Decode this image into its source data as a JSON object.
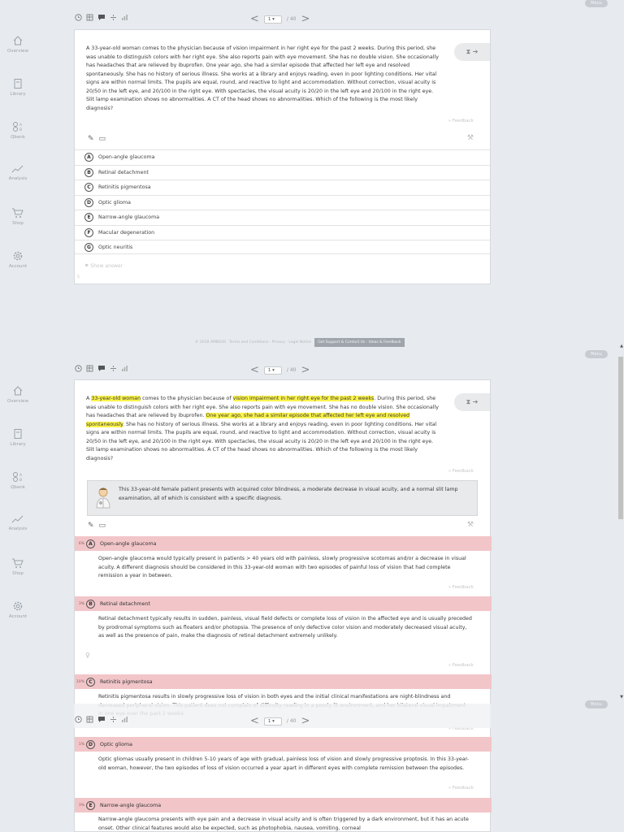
{
  "menu_label": "Menu",
  "sidebar": [
    {
      "label": "Overview",
      "icon": "home-icon"
    },
    {
      "label": "Library",
      "icon": "library-icon"
    },
    {
      "label": "Qbank",
      "icon": "qbank-icon"
    },
    {
      "label": "Analysis",
      "icon": "analysis-icon"
    },
    {
      "label": "Shop",
      "icon": "shop-icon"
    },
    {
      "label": "Account",
      "icon": "gear-icon"
    }
  ],
  "pager": {
    "current": "1",
    "total": "/ 40"
  },
  "question": {
    "stem": "A 33-year-old woman comes to the physician because of vision impairment in her right eye for the past 2 weeks. During this period, she was unable to distinguish colors with her right eye. She also reports pain with eye movement. She has no double vision. She occasionally has headaches that are relieved by ibuprofen. One year ago, she had a similar episode that affected her left eye and resolved spontaneously. She has no history of serious illness. She works at a library and enjoys reading, even in poor lighting conditions. Her vital signs are within normal limits. The pupils are equal, round, and reactive to light and accommodation. Without correction, visual acuity is 20/50 in the left eye, and 20/100 in the right eye. With spectacles, the visual acuity is 20/20 in the left eye and 20/100 in the right eye. Slit lamp examination shows no abnormalities. A CT of the head shows no abnormalities. Which of the following is the most likely diagnosis?",
    "stem_hl": {
      "p1": "A ",
      "h1": "33-year-old woman",
      "p2": " comes to the physician because of ",
      "h2": "vision impairment in her right eye for the past 2 weeks",
      "p3": ". During this period, she was unable to distinguish colors with her right eye. She also reports pain with eye movement. She has no double vision. She occasionally has headaches that are relieved by ibuprofen. ",
      "h3": "One year ago, she had a similar episode that affected her left eye and resolved spontaneously",
      "p4": ". She has no history of serious illness. She works at a library and enjoys reading, even in poor lighting conditions. Her vital signs are within normal limits. The pupils are equal, round, and reactive to light and accommodation. Without correction, visual acuity is 20/50 in the left eye, and 20/100 in the right eye. With spectacles, the visual acuity is 20/20 in the left eye and 20/100 in the right eye. Slit lamp examination shows no abnormalities. A CT of the head shows no abnormalities. Which of the following is the most likely diagnosis?"
    },
    "feedback": "» Feedback",
    "options": [
      {
        "letter": "A",
        "text": "Open-angle glaucoma"
      },
      {
        "letter": "B",
        "text": "Retinal detachment"
      },
      {
        "letter": "C",
        "text": "Retinitis pigmentosa"
      },
      {
        "letter": "D",
        "text": "Optic glioma"
      },
      {
        "letter": "E",
        "text": "Narrow-angle glaucoma"
      },
      {
        "letter": "F",
        "text": "Macular degeneration"
      },
      {
        "letter": "G",
        "text": "Optic neuritis"
      }
    ],
    "show_answer": "Show answer",
    "corner_num": "5"
  },
  "footer": {
    "copyright": "© 2018 AMBOSS",
    "links": "Terms and Conditions · Privacy · Legal Notice",
    "button": "Get Support & Contact Us · Ideas & Feedback"
  },
  "explanation": "This 33-year-old female patient presents with acquired color blindness, a moderate decrease in visual acuity, and a normal slit lamp examination, all of which is consistent with a specific diagnosis.",
  "answers": [
    {
      "pct": "6%",
      "letter": "A",
      "title": "Open-angle glaucoma",
      "body": "Open-angle glaucoma would typically present in patients > 40 years old with painless, slowly progressive scotomas and/or a decrease in visual acuity. A different diagnosis should be considered in this 33-year-old woman with two episodes of painful loss of vision that had complete remission a year in between."
    },
    {
      "pct": "3%",
      "letter": "B",
      "title": "Retinal detachment",
      "body": "Retinal detachment typically results in sudden, painless, visual field defects or complete loss of vision in the affected eye and is usually preceded by prodromal symptoms such as floaters and/or photopsia. The presence of only defective color vision and moderately decreased visual acuity, as well as the presence of pain, make the diagnosis of retinal detachment extremely unlikely."
    },
    {
      "pct": "10%",
      "letter": "C",
      "title": "Retinitis pigmentosa",
      "body": "Retinitis pigmentosa results in slowly progressive loss of vision in both eyes and the initial clinical manifestations are night-blindness and decreased peripheral vision. This patient does not complain of difficulty reading in a poorly lit environment, and her bilateral visual impairment in one eye over the past 2 weeks."
    },
    {
      "pct": "1%",
      "letter": "D",
      "title": "Optic glioma",
      "body": "Optic gliomas usually present in children 5-10 years of age with gradual, painless loss of vision and slowly progressive proptosis. In this 33-year-old woman, however, the two episodes of loss of vision occurred a year apart in different eyes with complete remission between the episodes."
    },
    {
      "pct": "3%",
      "letter": "E",
      "title": "Narrow-angle glaucoma",
      "body": "Narrow-angle glaucoma presents with eye pain and a decrease in visual acuity and is often triggered by a dark environment, but it has an acute onset. Other clinical features would also be expected, such as photophobia, nausea, vomiting, corneal"
    }
  ]
}
